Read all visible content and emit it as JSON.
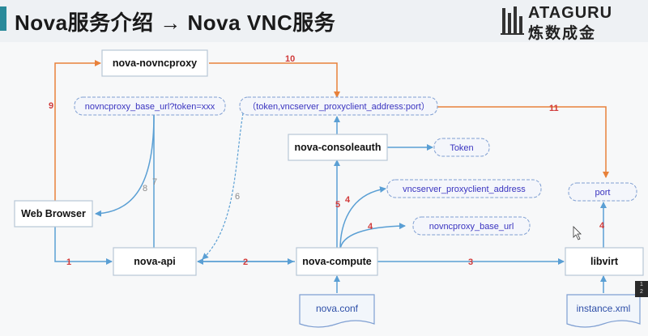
{
  "header": {
    "title": "Nova服务介绍 → Nova VNC服务",
    "logo_top": "ATAGURU",
    "logo_bottom": "炼数成金"
  },
  "colors": {
    "accent": "#2a8a9a",
    "orange": "#e8813a",
    "blue": "#5a9fd4",
    "red_label": "#d13a3a",
    "pill_text": "#3a34c0"
  },
  "nodes": {
    "novncproxy": "nova-novncproxy",
    "consoleauth": "nova-consoleauth",
    "web_browser": "Web Browser",
    "api": "nova-api",
    "compute": "nova-compute",
    "libvirt": "libvirt"
  },
  "pills": {
    "base_url_token": "novncproxy_base_url?token=xxx",
    "token_address": "（token,vncserver_proxyclient_address:port）",
    "token": "Token",
    "vnc_address": "vncserver_proxyclient_address",
    "port": "port",
    "base_url": "novncproxy_base_url"
  },
  "files": {
    "nova_conf": "nova.conf",
    "instance_xml": "instance.xml"
  },
  "steps": {
    "s1": "1",
    "s2": "2",
    "s3": "3",
    "s4a": "4",
    "s4b": "4",
    "s4c": "4",
    "s5": "5",
    "s6": "6",
    "s7": "7",
    "s8": "8",
    "s9": "9",
    "s10": "10",
    "s11": "11"
  },
  "side_tab": [
    "1",
    "2"
  ]
}
